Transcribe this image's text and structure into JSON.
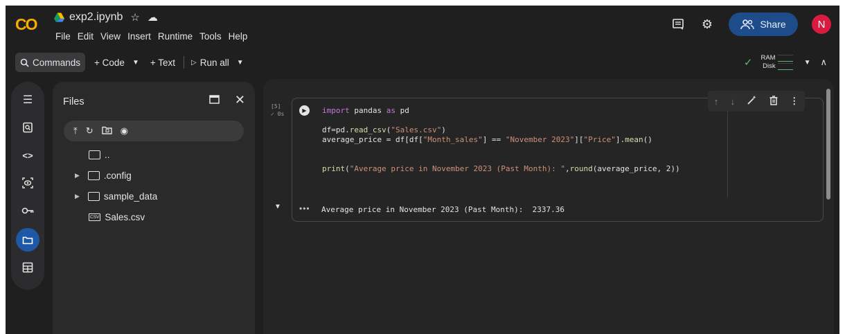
{
  "app": {
    "logo": "CO",
    "notebook_name": "exp2.ipynb",
    "menu": [
      "File",
      "Edit",
      "View",
      "Insert",
      "Runtime",
      "Tools",
      "Help"
    ],
    "share_label": "Share",
    "avatar_initial": "N"
  },
  "toolbar": {
    "commands_label": "Commands",
    "code_label": "+ Code",
    "text_label": "+ Text",
    "run_all_label": "Run all",
    "ram_label": "RAM",
    "disk_label": "Disk"
  },
  "rail": {
    "icons": [
      "table-of-contents-icon",
      "find-replace-icon",
      "code-snippets-icon",
      "variables-icon",
      "secrets-key-icon",
      "files-folder-icon",
      "data-table-icon"
    ],
    "active": "files-folder-icon"
  },
  "files": {
    "title": "Files",
    "items": [
      {
        "name": "..",
        "type": "folder",
        "expandable": false
      },
      {
        "name": ".config",
        "type": "folder",
        "expandable": true
      },
      {
        "name": "sample_data",
        "type": "folder",
        "expandable": true
      },
      {
        "name": "Sales.csv",
        "type": "csv",
        "expandable": false
      }
    ]
  },
  "cell": {
    "exec_count": "[5]",
    "exec_time": "0s",
    "code_lines": [
      "import pandas as pd",
      "",
      "df=pd.read_csv(\"Sales.csv\")",
      "average_price = df[df[\"Month_sales\"] == \"November 2023\"][\"Price\"].mean()",
      "",
      "",
      "print(\"Average price in November 2023 (Past Month): \",round(average_price, 2))"
    ],
    "output": "Average price in November 2023 (Past Month):  2337.36"
  },
  "colors": {
    "background": "#1f1f1f",
    "accent_blue": "#1e4c8a",
    "avatar_red": "#d81b3e",
    "success_green": "#5bb974"
  }
}
